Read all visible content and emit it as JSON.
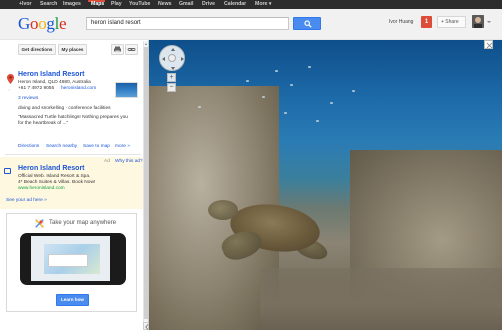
{
  "topnav": {
    "items": [
      "+Ivor",
      "Search",
      "Images",
      "Maps",
      "Play",
      "YouTube",
      "News",
      "Gmail",
      "Drive",
      "Calendar",
      "More"
    ],
    "more_suffix": "▾",
    "active": "Maps",
    "active_color": "#dd4b39"
  },
  "header": {
    "logo": "Google",
    "search_value": "heron island resort",
    "search_icon": "search-icon",
    "username": "Ivor Huang",
    "notifications": "1",
    "share_label": "+ Share",
    "accent": "#4a8bf0"
  },
  "sidebar": {
    "get_directions": "Get directions",
    "my_places": "My places",
    "place": {
      "name": "Heron Island Resort",
      "address": "Heron Island, QLD 4680, Australia",
      "phone": "+61 7 4972 9055",
      "website": "heronisland.com",
      "reviews": "3 reviews",
      "tags": "diving and snorkelling · conference facilities",
      "quote_1": "\"Massacred Turtle hatchlings! Nothing prepares you",
      "quote_2": "for the heartbreak of ...\""
    },
    "actions": {
      "directions": "Directions",
      "search_nearby": "Search nearby",
      "save_to_map": "Save to map",
      "more": "more »"
    },
    "ad": {
      "ad_label": "Ad",
      "why": "Why this ad?",
      "title": "Heron Island Resort",
      "line1": "Official Web. Island Resort & Spa.",
      "line2": "4* Beach Suites & Villas. Book Now!",
      "url": "www.heronisland.com",
      "see_more": "See your ad here »"
    },
    "promo": {
      "headline": "Take your map anywhere",
      "learn_more": "Learn how"
    }
  },
  "map": {
    "zoom_in": "+",
    "zoom_out": "−"
  }
}
